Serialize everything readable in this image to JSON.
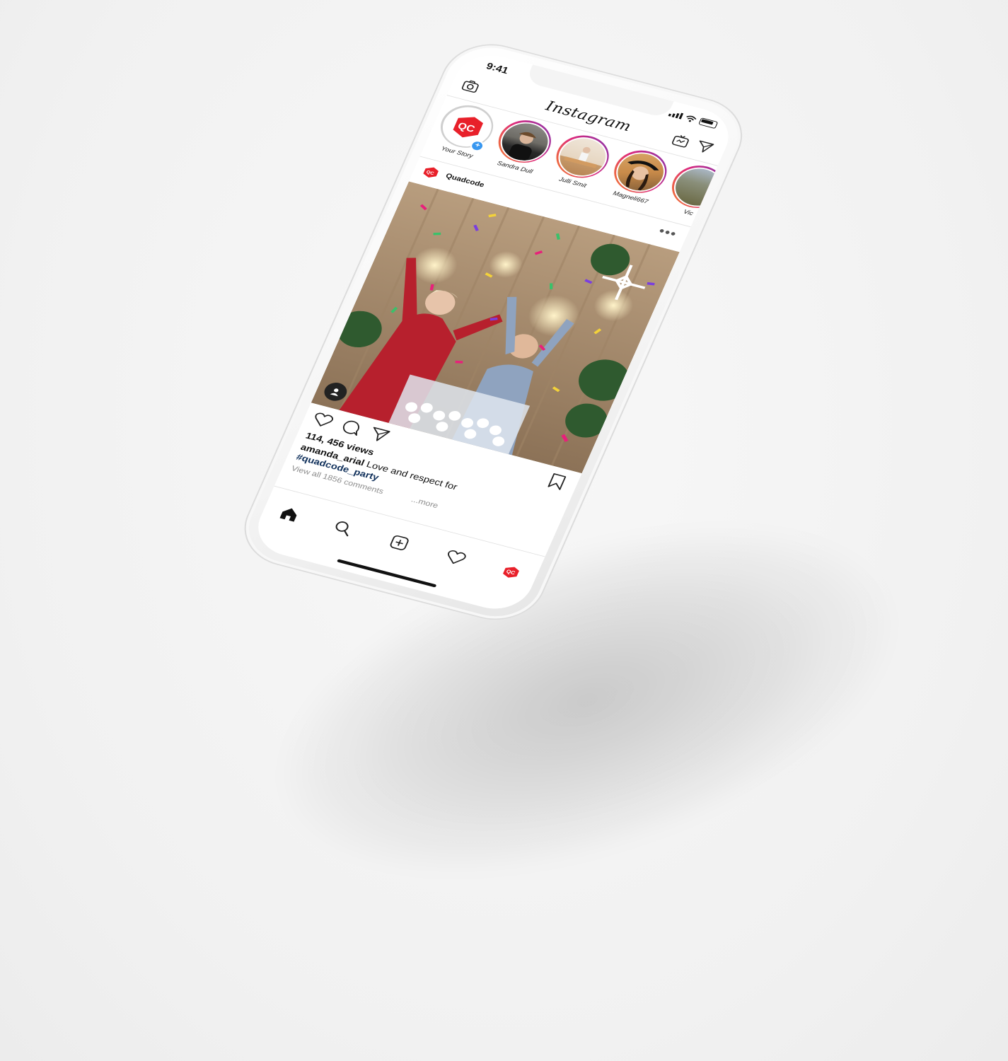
{
  "status_bar": {
    "time": "9:41"
  },
  "header": {
    "app_title": "Instagram"
  },
  "stories": [
    {
      "label": "Your Story",
      "is_own": true
    },
    {
      "label": "Sandra Dull"
    },
    {
      "label": "Julli Smit"
    },
    {
      "label": "Magneli667"
    },
    {
      "label": "Vic"
    }
  ],
  "post": {
    "username": "Quadcode",
    "more_label": "•••",
    "views": "114, 456 views",
    "caption_user": "amanda_arial",
    "caption_text": " Love and respect for",
    "hashtag": "#quadcode_party",
    "comments_link": "View all 1856 comments",
    "more_link": "...more"
  },
  "colors": {
    "brand_red": "#e8202a",
    "story_ring_start": "#f58529",
    "story_ring_end": "#8134af",
    "hashtag": "#10305b"
  },
  "icons": [
    "camera-icon",
    "igtv-icon",
    "direct-message-icon",
    "like-icon",
    "comment-icon",
    "share-icon",
    "bookmark-icon",
    "home-icon",
    "search-icon",
    "new-post-icon",
    "activity-icon",
    "profile-icon",
    "user-tag-icon"
  ]
}
